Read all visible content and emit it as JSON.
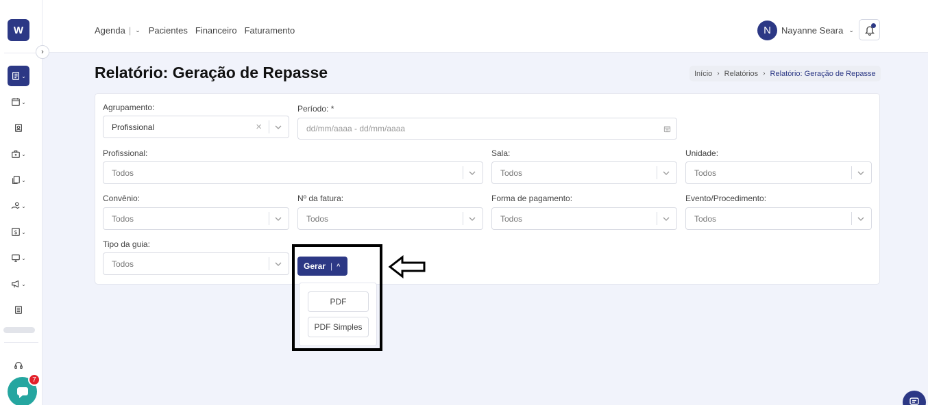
{
  "app": {
    "logo_text": "W"
  },
  "header": {
    "nav": {
      "agenda": "Agenda",
      "pacientes": "Pacientes",
      "financeiro": "Financeiro",
      "faturamento": "Faturamento"
    },
    "user": {
      "initial": "N",
      "name": "Nayanne Seara"
    }
  },
  "sidebar": {
    "icons": [
      "notebook-icon",
      "calendar-icon",
      "patient-badge-icon",
      "briefcase-icon",
      "documents-icon",
      "hand-money-icon",
      "dollar-icon",
      "monitor-icon",
      "megaphone-icon",
      "report-icon",
      "headset-icon"
    ],
    "chat_badge": "7"
  },
  "page": {
    "title": "Relatório: Geração de Repasse",
    "breadcrumb": [
      "Início",
      "Relatórios",
      "Relatório: Geração de Repasse"
    ]
  },
  "form": {
    "agrupamento": {
      "label": "Agrupamento:",
      "value": "Profissional"
    },
    "periodo": {
      "label": "Período: *",
      "placeholder": "dd/mm/aaaa - dd/mm/aaaa"
    },
    "profissional": {
      "label": "Profissional:",
      "value": "Todos"
    },
    "sala": {
      "label": "Sala:",
      "value": "Todos"
    },
    "unidade": {
      "label": "Unidade:",
      "value": "Todos"
    },
    "convenio": {
      "label": "Convênio:",
      "value": "Todos"
    },
    "fatura": {
      "label": "Nº da fatura:",
      "value": "Todos"
    },
    "pagamento": {
      "label": "Forma de pagamento:",
      "value": "Todos"
    },
    "evento": {
      "label": "Evento/Procedimento:",
      "value": "Todos"
    },
    "tipo_guia": {
      "label": "Tipo da guia:",
      "value": "Todos"
    }
  },
  "actions": {
    "gerar_label": "Gerar",
    "menu": {
      "pdf": "PDF",
      "pdf_simples": "PDF Simples"
    }
  }
}
